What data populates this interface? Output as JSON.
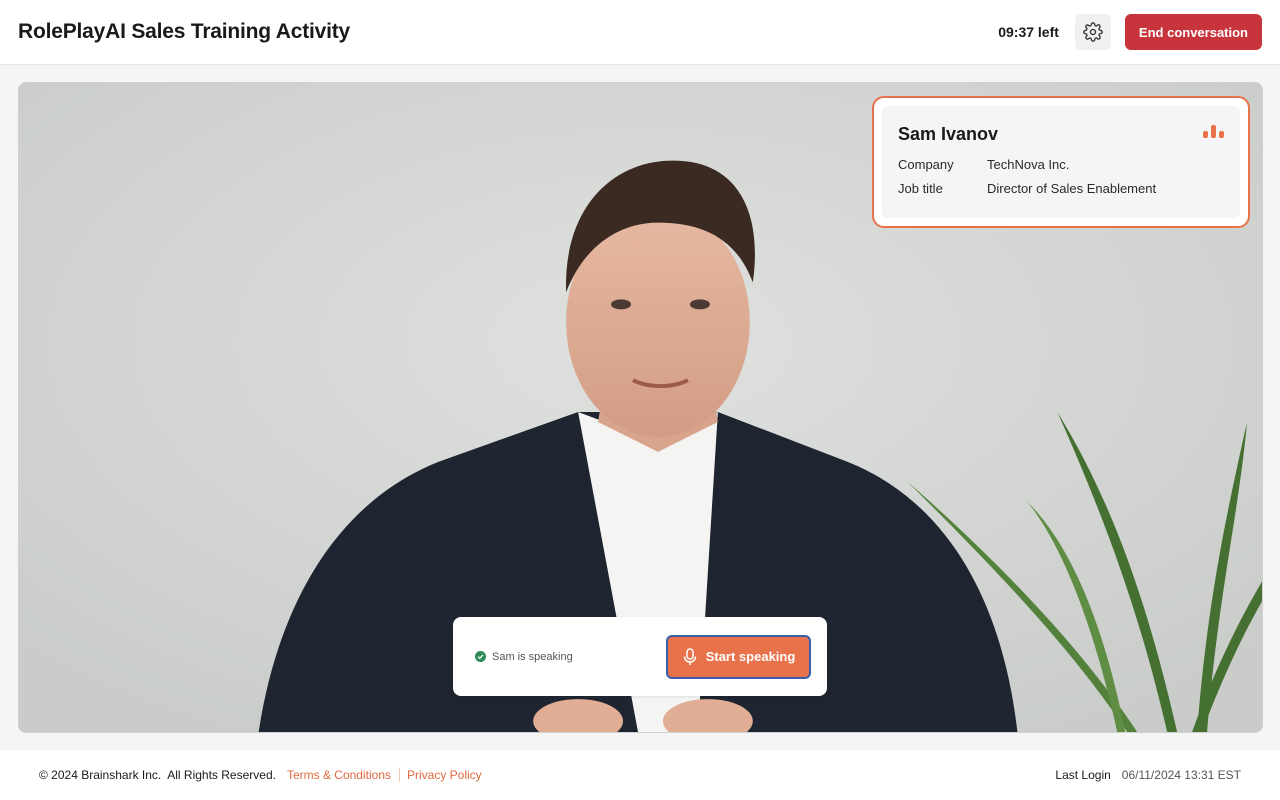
{
  "header": {
    "title": "RolePlayAI Sales Training Activity",
    "timer": "09:37 left",
    "settings_icon": "gear-icon",
    "end_label": "End conversation"
  },
  "persona": {
    "name": "Sam Ivanov",
    "audio_icon": "audio-level-icon",
    "fields": [
      {
        "label": "Company",
        "value": "TechNova Inc."
      },
      {
        "label": "Job title",
        "value": "Director of Sales Enablement"
      }
    ]
  },
  "controls": {
    "status": "Sam is speaking",
    "status_icon": "check-circle-icon",
    "speak_label": "Start speaking",
    "speak_icon": "microphone-icon"
  },
  "footer": {
    "copyright": "© 2024 Brainshark Inc.  All Rights Reserved.",
    "terms": "Terms & Conditions",
    "privacy": "Privacy Policy",
    "last_login_label": "Last Login",
    "last_login_value": "06/11/2024 13:31 EST"
  },
  "colors": {
    "accent": "#e8734a",
    "danger": "#c8343b",
    "status_ok": "#2e8b57"
  }
}
